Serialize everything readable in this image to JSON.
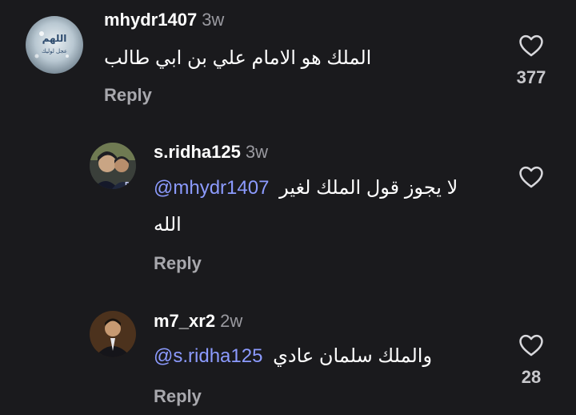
{
  "comments": [
    {
      "username": "mhydr1407",
      "age": "3w",
      "text": "الملك هو الامام علي بن ابي طالب",
      "reply_label": "Reply",
      "like_count": "377",
      "avatar_icon": "profile-photo"
    },
    {
      "username": "s.ridha125",
      "age": "3w",
      "text_before": "لا يجوز قول الملك لغير",
      "mention": "@mhydr1407",
      "text_after": "الله",
      "reply_label": "Reply",
      "avatar_icon": "profile-photo"
    },
    {
      "username": "m7_xr2",
      "age": "2w",
      "text_before": "والملك سلمان عادي",
      "mention": "@s.ridha125",
      "reply_label": "Reply",
      "like_count": "28",
      "avatar_icon": "profile-photo"
    }
  ],
  "avatar_texts": {
    "c1_line1": "اللهم",
    "c1_line2": "عجل لوليك"
  },
  "icons": {
    "like": "heart-outline-icon"
  },
  "colors": {
    "background": "#1a1a1d",
    "mention": "#8c9bff",
    "secondary": "#a8a8ad"
  }
}
